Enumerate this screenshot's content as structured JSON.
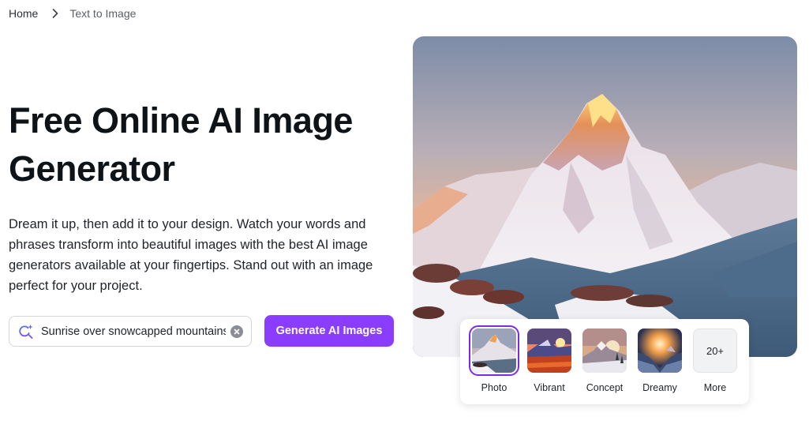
{
  "breadcrumb": {
    "items": [
      {
        "label": "Home"
      },
      {
        "label": "Text to Image"
      }
    ],
    "separator_icon": "chevron-right-icon"
  },
  "hero": {
    "title": "Free Online AI Image Generator",
    "description": "Dream it up, then add it to your design. Watch your words and phrases transform into beautiful images with the best AI image generators available at your fingertips. Stand out with an image perfect for your project."
  },
  "prompt": {
    "value": "Sunrise over snowcapped mountains",
    "icon": "magic-search-icon",
    "clear_icon": "clear-icon"
  },
  "generate_button": {
    "label": "Generate AI Images",
    "color": "#8b3dff"
  },
  "preview": {
    "alt": "Snowcapped mountain at sunrise"
  },
  "styles": {
    "selected": "Photo",
    "selected_color": "#7d2ae8",
    "items": [
      {
        "label": "Photo"
      },
      {
        "label": "Vibrant"
      },
      {
        "label": "Concept"
      },
      {
        "label": "Dreamy"
      },
      {
        "label": "More",
        "badge": "20+"
      }
    ]
  }
}
